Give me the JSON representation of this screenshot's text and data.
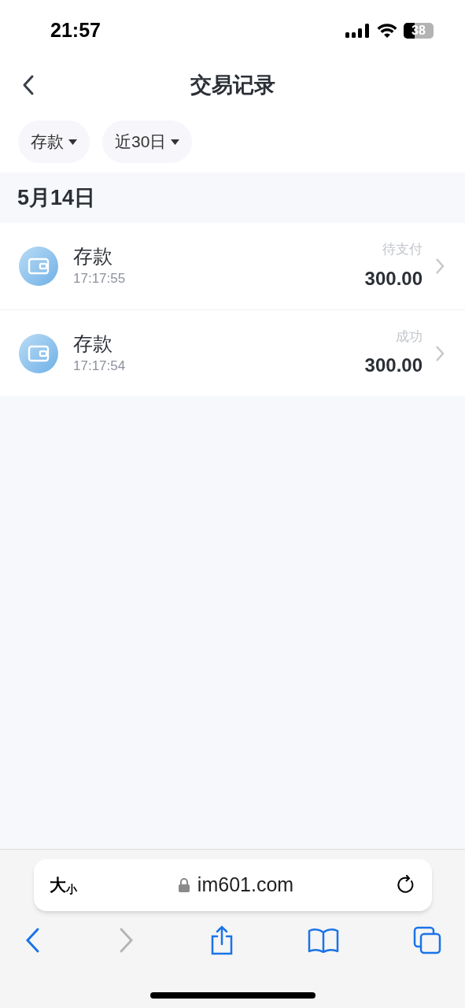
{
  "status_bar": {
    "time": "21:57",
    "battery": "38"
  },
  "header": {
    "title": "交易记录"
  },
  "filters": [
    {
      "label": "存款"
    },
    {
      "label": "近30日"
    }
  ],
  "sections": [
    {
      "date": "5月14日",
      "rows": [
        {
          "title": "存款",
          "time": "17:17:55",
          "status": "待支付",
          "amount": "300.00"
        },
        {
          "title": "存款",
          "time": "17:17:54",
          "status": "成功",
          "amount": "300.00"
        }
      ]
    }
  ],
  "browser": {
    "text_size": {
      "large": "大",
      "small": "小"
    },
    "url": "im601.com",
    "forward_disabled": true
  }
}
